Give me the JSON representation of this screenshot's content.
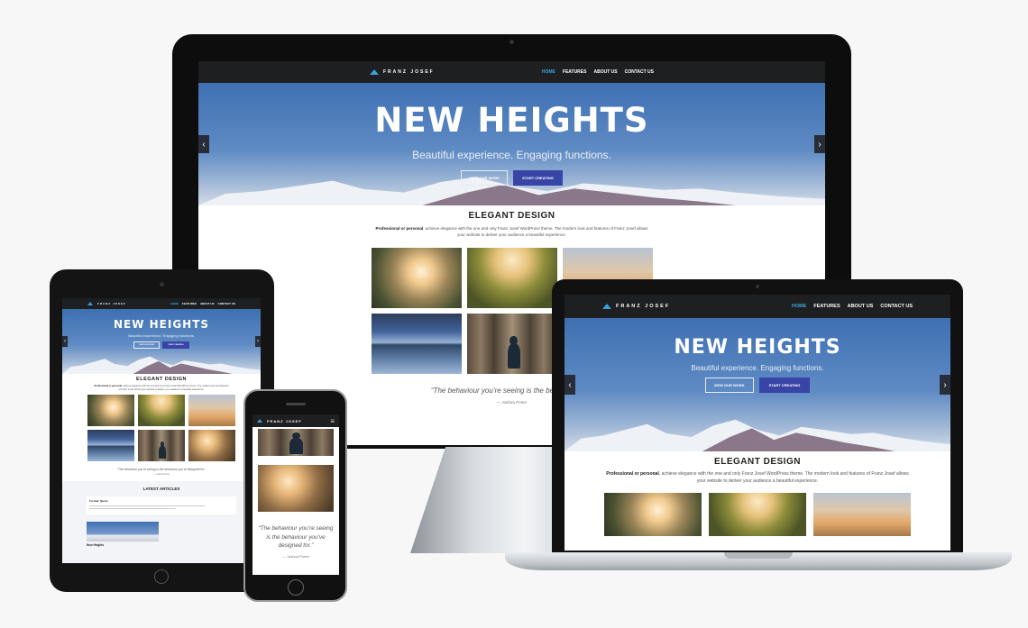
{
  "site": {
    "logo_text": "FRANZ JOSEF",
    "menu": [
      "HOME",
      "FEATURES",
      "ABOUT US",
      "CONTACT US"
    ],
    "hero_title": "NEW HEIGHTS",
    "hero_subtitle": "Beautiful experience. Engaging functions.",
    "btn_view": "VIEW OUR WORK",
    "btn_start": "START CREATING",
    "section_title": "ELEGANT DESIGN",
    "lead_bold": "Professional or personal",
    "lead_rest": ", achieve elegance with the one and only Franz Josef WordPress theme. The modern look and features of Franz Josef allows your website to deliver your audience a beautiful experience.",
    "quote": "“The behaviour you’re seeing is the behaviour you’ve designed for.”",
    "quote_short": "“The behaviour you’re seeing is the behaviour you’",
    "cite": "— Joshua Porter",
    "latest_title": "LATEST ARTICLES",
    "article1_title": "Format: Quote",
    "article2_title": "New Heights",
    "arrow_prev": "‹",
    "arrow_next": "›",
    "hamburger": "≡"
  },
  "colors": {
    "nav_bg": "#1e1f21",
    "accent": "#39a6dd",
    "button": "#3845a6",
    "hero_sky": "#3e70b2"
  }
}
